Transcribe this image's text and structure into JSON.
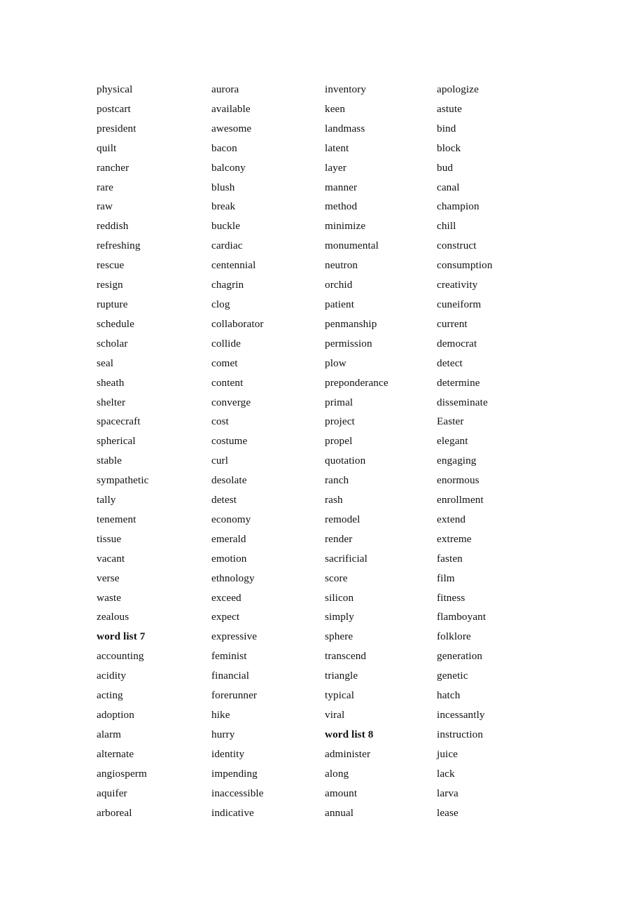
{
  "document": {
    "type": "word-list-page",
    "page_background": "#ffffff",
    "text_color": "#111111",
    "columns_count": 4,
    "rows_count": 38,
    "section_headings": [
      "word list 7",
      "word list 8"
    ]
  },
  "columns": [
    {
      "index": 1,
      "words": [
        "physical",
        "postcart",
        "president",
        "quilt",
        "rancher",
        "rare",
        "raw",
        "reddish",
        "refreshing",
        "rescue",
        "resign",
        "rupture",
        "schedule",
        "scholar",
        "seal",
        "sheath",
        "shelter",
        "spacecraft",
        "spherical",
        "stable",
        "sympathetic",
        "tally",
        "tenement",
        "tissue",
        "vacant",
        "verse",
        "waste",
        "zealous",
        "word list 7",
        "accounting",
        "acidity",
        "acting",
        "adoption",
        "alarm",
        "alternate",
        "angiosperm",
        "aquifer",
        "arboreal"
      ],
      "bold_indices": [
        28
      ]
    },
    {
      "index": 2,
      "words": [
        "aurora",
        "available",
        "awesome",
        "bacon",
        "balcony",
        "blush",
        "break",
        "buckle",
        "cardiac",
        "centennial",
        "chagrin",
        "clog",
        "collaborator",
        "collide",
        "comet",
        "content",
        "converge",
        "cost",
        "costume",
        "curl",
        "desolate",
        "detest",
        "economy",
        "emerald",
        "emotion",
        "ethnology",
        "exceed",
        "expect",
        "expressive",
        "feminist",
        "financial",
        "forerunner",
        "hike",
        "hurry",
        "identity",
        "impending",
        "inaccessible",
        "indicative"
      ],
      "bold_indices": []
    },
    {
      "index": 3,
      "words": [
        "inventory",
        "keen",
        "landmass",
        "latent",
        "layer",
        "manner",
        "method",
        "minimize",
        "monumental",
        "neutron",
        "orchid",
        "patient",
        "penmanship",
        "permission",
        "plow",
        "preponderance",
        "primal",
        "project",
        "propel",
        "quotation",
        "ranch",
        "rash",
        "remodel",
        "render",
        "sacrificial",
        "score",
        "silicon",
        "simply",
        "sphere",
        "transcend",
        "triangle",
        "typical",
        "viral",
        "word list 8",
        "administer",
        "along",
        "amount",
        "annual"
      ],
      "bold_indices": [
        33
      ]
    },
    {
      "index": 4,
      "words": [
        "apologize",
        "astute",
        "bind",
        "block",
        "bud",
        "canal",
        "champion",
        "chill",
        "construct",
        "consumption",
        "creativity",
        "cuneiform",
        "current",
        "democrat",
        "detect",
        "determine",
        "disseminate",
        "Easter",
        "elegant",
        "engaging",
        "enormous",
        "enrollment",
        "extend",
        "extreme",
        "fasten",
        "film",
        "fitness",
        "flamboyant",
        "folklore",
        "generation",
        "genetic",
        "hatch",
        "incessantly",
        "instruction",
        "juice",
        "lack",
        "larva",
        "lease"
      ],
      "bold_indices": []
    }
  ]
}
